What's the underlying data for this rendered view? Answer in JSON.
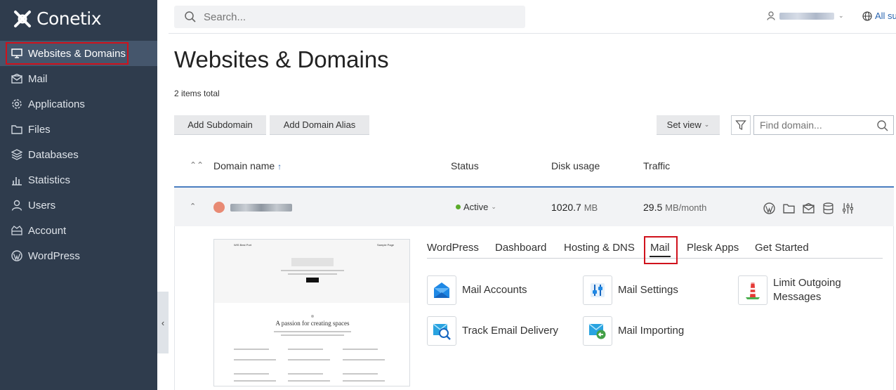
{
  "brand": {
    "name": "Conetix"
  },
  "sidebar": {
    "items": [
      {
        "label": "Websites & Domains",
        "icon": "monitor-icon",
        "active": true
      },
      {
        "label": "Mail",
        "icon": "envelope-icon"
      },
      {
        "label": "Applications",
        "icon": "gear-icon"
      },
      {
        "label": "Files",
        "icon": "folder-icon"
      },
      {
        "label": "Databases",
        "icon": "database-icon"
      },
      {
        "label": "Statistics",
        "icon": "bar-chart-icon"
      },
      {
        "label": "Users",
        "icon": "user-icon"
      },
      {
        "label": "Account",
        "icon": "briefcase-icon"
      },
      {
        "label": "WordPress",
        "icon": "wordpress-icon"
      }
    ]
  },
  "topbar": {
    "search_placeholder": "Search...",
    "subscription_label": "All su"
  },
  "page": {
    "title": "Websites & Domains",
    "items_total": "2 items total"
  },
  "toolbar": {
    "add_subdomain": "Add Subdomain",
    "add_domain_alias": "Add Domain Alias",
    "set_view": "Set view",
    "find_placeholder": "Find domain..."
  },
  "table": {
    "columns": {
      "domain": "Domain name",
      "status": "Status",
      "disk": "Disk usage",
      "traffic": "Traffic"
    },
    "row": {
      "status": "Active",
      "disk_value": "1020.7",
      "disk_unit": "MB",
      "traffic_value": "29.5",
      "traffic_unit": "MB/month"
    }
  },
  "preview": {
    "nav_left": "WIS Best Port",
    "nav_right": "Sample Page",
    "heading": "A passion for creating spaces"
  },
  "tabs": [
    "WordPress",
    "Dashboard",
    "Hosting & DNS",
    "Mail",
    "Plesk Apps",
    "Get Started"
  ],
  "mail_tools": [
    {
      "label": "Mail Accounts",
      "icon": "mail-accounts-icon"
    },
    {
      "label": "Mail Settings",
      "icon": "mail-settings-icon"
    },
    {
      "label": "Limit Outgoing Messages",
      "icon": "limit-outgoing-icon"
    },
    {
      "label": "Track Email Delivery",
      "icon": "track-email-icon"
    },
    {
      "label": "Mail Importing",
      "icon": "mail-importing-icon"
    }
  ],
  "colors": {
    "sidebar_bg": "#2f3c4d",
    "active_item_bg": "#45566c",
    "highlight_red": "#d0121c",
    "link_blue": "#2a65b0",
    "status_green": "#5bab2a"
  }
}
